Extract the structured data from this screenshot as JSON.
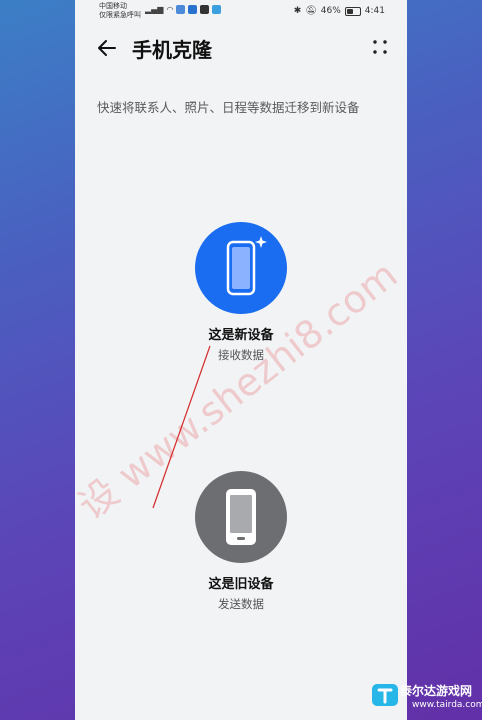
{
  "status_bar": {
    "carrier_line1": "中国移动",
    "carrier_line2": "仅限紧急呼叫",
    "battery_pct": "46%",
    "time": "4:41",
    "battery_level": 0.46
  },
  "header": {
    "title": "手机克隆"
  },
  "description": "快速将联系人、照片、日程等数据迁移到新设备",
  "options": {
    "new_device": {
      "label": "这是新设备",
      "sub": "接收数据",
      "color": "#1a6cf0"
    },
    "old_device": {
      "label": "这是旧设备",
      "sub": "发送数据",
      "color": "#6c6e72"
    }
  },
  "watermark": "设 www.shezhi8.com",
  "corner_logo": {
    "name": "泰尔达游戏网",
    "url": "www.tairda.com"
  },
  "icons": [
    "back-arrow-icon",
    "more-dots-icon",
    "new-phone-icon",
    "sparkle-icon",
    "old-phone-icon",
    "bluetooth-icon",
    "mute-icon",
    "battery-icon",
    "wifi-icon",
    "signal-icon"
  ]
}
